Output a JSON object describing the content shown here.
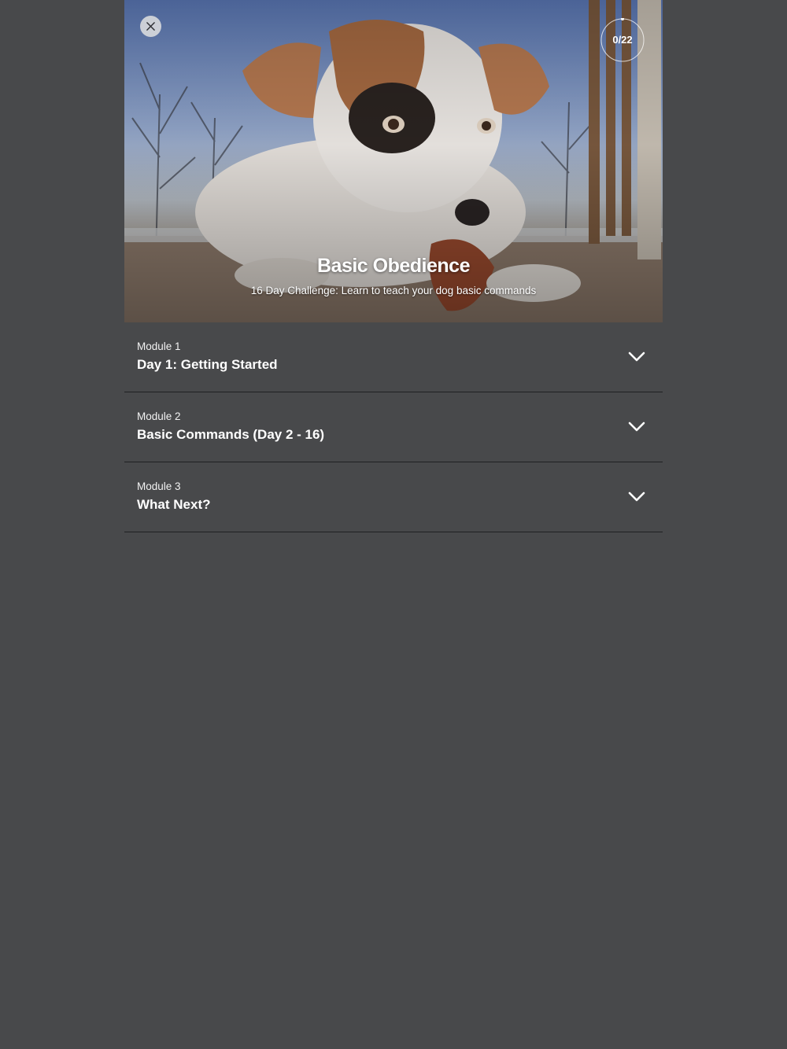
{
  "course": {
    "title": "Basic Obedience",
    "subtitle": "16 Day Challenge: Learn to teach your dog basic commands",
    "progress_text": "0/22",
    "progress_value": 0
  },
  "icons": {
    "close": "close-icon",
    "chevron": "chevron-down-icon"
  },
  "colors": {
    "background": "#48494b",
    "divider": "#1f2022",
    "text": "#ffffff"
  },
  "modules": [
    {
      "label": "Module 1",
      "title": "Day 1: Getting Started"
    },
    {
      "label": "Module 2",
      "title": "Basic Commands (Day 2 - 16)"
    },
    {
      "label": "Module 3",
      "title": "What Next?"
    }
  ]
}
